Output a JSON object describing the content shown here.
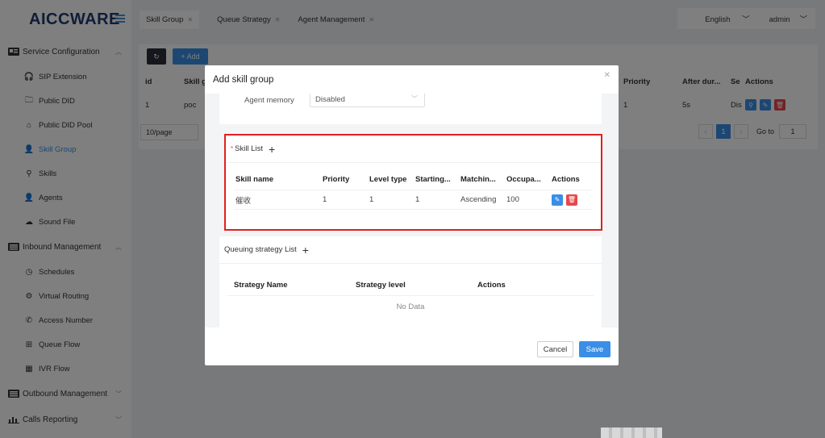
{
  "app": {
    "logo": "AICCWARE"
  },
  "topbar": {
    "tabs": [
      {
        "label": "Skill Group"
      },
      {
        "label": "Queue Strategy"
      },
      {
        "label": "Agent Management"
      }
    ],
    "language": "English",
    "user": "admin"
  },
  "sidebar": {
    "groups": [
      {
        "label": "Service Configuration"
      },
      {
        "label": "Inbound Management"
      },
      {
        "label": "Outbound Management"
      },
      {
        "label": "Calls Reporting"
      }
    ],
    "items_service": [
      {
        "label": "SIP Extension"
      },
      {
        "label": "Public DID"
      },
      {
        "label": "Public DID Pool"
      },
      {
        "label": "Skill Group"
      },
      {
        "label": "Skills"
      },
      {
        "label": "Agents"
      },
      {
        "label": "Sound File"
      }
    ],
    "items_inbound": [
      {
        "label": "Schedules"
      },
      {
        "label": "Virtual Routing"
      },
      {
        "label": "Access Number"
      },
      {
        "label": "Queue Flow"
      },
      {
        "label": "IVR Flow"
      }
    ]
  },
  "main": {
    "add_label": "+ Add",
    "columns": {
      "id": "id",
      "skill": "Skill g",
      "priority": "Priority",
      "after": "After dur...",
      "se": "Se",
      "actions": "Actions"
    },
    "row": {
      "id": "1",
      "skill": "poc",
      "priority": "1",
      "after": "5s",
      "se": "Dis"
    },
    "page_size": "10/page",
    "page": "1",
    "goto_label": "Go to",
    "goto_value": "1"
  },
  "modal": {
    "title": "Add skill group",
    "agent_memory_label": "Agent memory",
    "agent_memory_value": "Disabled",
    "skill_list": {
      "title": "Skill List",
      "columns": {
        "name": "Skill name",
        "priority": "Priority",
        "level": "Level type",
        "starting": "Starting...",
        "matching": "Matchin...",
        "occupa": "Occupa...",
        "actions": "Actions"
      },
      "rows": [
        {
          "name": "催收",
          "priority": "1",
          "level": "1",
          "starting": "1",
          "matching": "Ascending",
          "occupa": "100"
        }
      ]
    },
    "queue_list": {
      "title": "Queuing strategy List",
      "columns": {
        "name": "Strategy Name",
        "level": "Strategy level",
        "actions": "Actions"
      },
      "empty": "No Data"
    },
    "cancel": "Cancel",
    "save": "Save"
  }
}
